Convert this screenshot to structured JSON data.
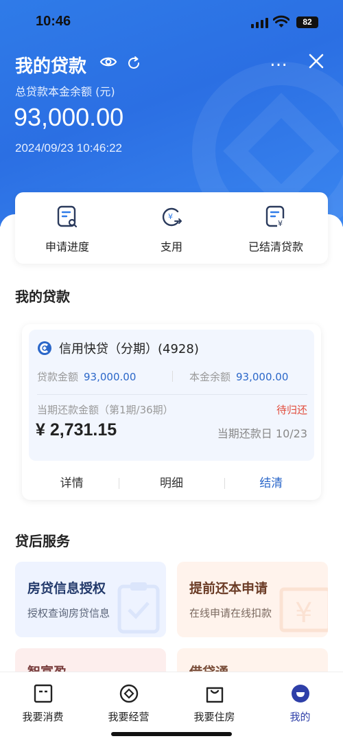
{
  "status_bar": {
    "time": "10:46",
    "battery": "82"
  },
  "header": {
    "title": "我的贷款",
    "subtitle": "总贷款本金余额 (元)",
    "amount": "93,000.00",
    "datetime": "2024/09/23 10:46:22",
    "more_icon": "…"
  },
  "quick_actions": [
    {
      "label": "申请进度",
      "icon": "application-progress-icon"
    },
    {
      "label": "支用",
      "icon": "withdraw-icon"
    },
    {
      "label": "已结清贷款",
      "icon": "settled-loan-icon"
    }
  ],
  "my_loans_title": "我的贷款",
  "loan": {
    "name": "信用快贷（分期）(4928)",
    "loan_amount_label": "贷款金额",
    "loan_amount": "93,000.00",
    "principal_label": "本金余额",
    "principal": "93,000.00",
    "current_label": "当期还款金额（第1期/36期）",
    "status": "待归还",
    "current_amount": "¥ 2,731.15",
    "due": "当期还款日 10/23",
    "actions": [
      "详情",
      "明细",
      "结清"
    ]
  },
  "services_title": "贷后服务",
  "services": [
    {
      "title": "房贷信息授权",
      "desc": "授权查询房贷信息"
    },
    {
      "title": "提前还本申请",
      "desc": "在线申请在线扣款"
    },
    {
      "title": "智富盈",
      "desc": ""
    },
    {
      "title": "借贷通",
      "desc": ""
    }
  ],
  "tabs": [
    {
      "label": "我要消费",
      "icon": "consume-icon"
    },
    {
      "label": "我要经营",
      "icon": "business-icon"
    },
    {
      "label": "我要住房",
      "icon": "housing-icon"
    },
    {
      "label": "我的",
      "icon": "profile-icon"
    }
  ],
  "colors": {
    "primary": "#2b6fe3",
    "accent_blue": "#2b67c9",
    "warning": "#e14b3b",
    "tab_active": "#2e3fa8"
  }
}
